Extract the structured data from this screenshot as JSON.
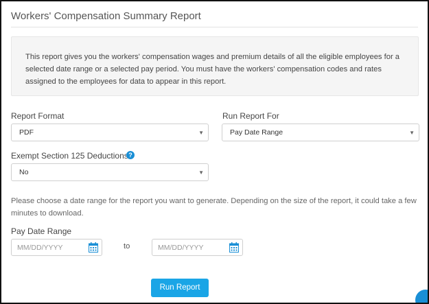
{
  "page": {
    "title": "Workers' Compensation Summary Report",
    "info": "This report gives you the workers' compensation wages and premium details of all the eligible employees for a selected date range or a selected pay period. You must have the workers' compensation codes and rates assigned to the employees for data to appear in this report."
  },
  "form": {
    "report_format": {
      "label": "Report Format",
      "value": "PDF"
    },
    "run_report_for": {
      "label": "Run Report For",
      "value": "Pay Date Range"
    },
    "exempt_section_125": {
      "label": "Exempt Section 125 Deductions?",
      "value": "No"
    },
    "note": "Please choose a date range for the report you want to generate. Depending on the size of the report, it could take a few minutes to download.",
    "pay_date_range": {
      "label": "Pay Date Range",
      "start_placeholder": "MM/DD/YYYY",
      "end_placeholder": "MM/DD/YYYY",
      "separator": "to"
    },
    "run_button": "Run Report"
  },
  "icons": {
    "help": "question-circle-icon",
    "calendar": "calendar-icon",
    "caret": "chevron-down-icon"
  },
  "colors": {
    "accent": "#1aa5e6",
    "help_icon": "#1a8fd6",
    "info_bg": "#f5f5f5"
  }
}
